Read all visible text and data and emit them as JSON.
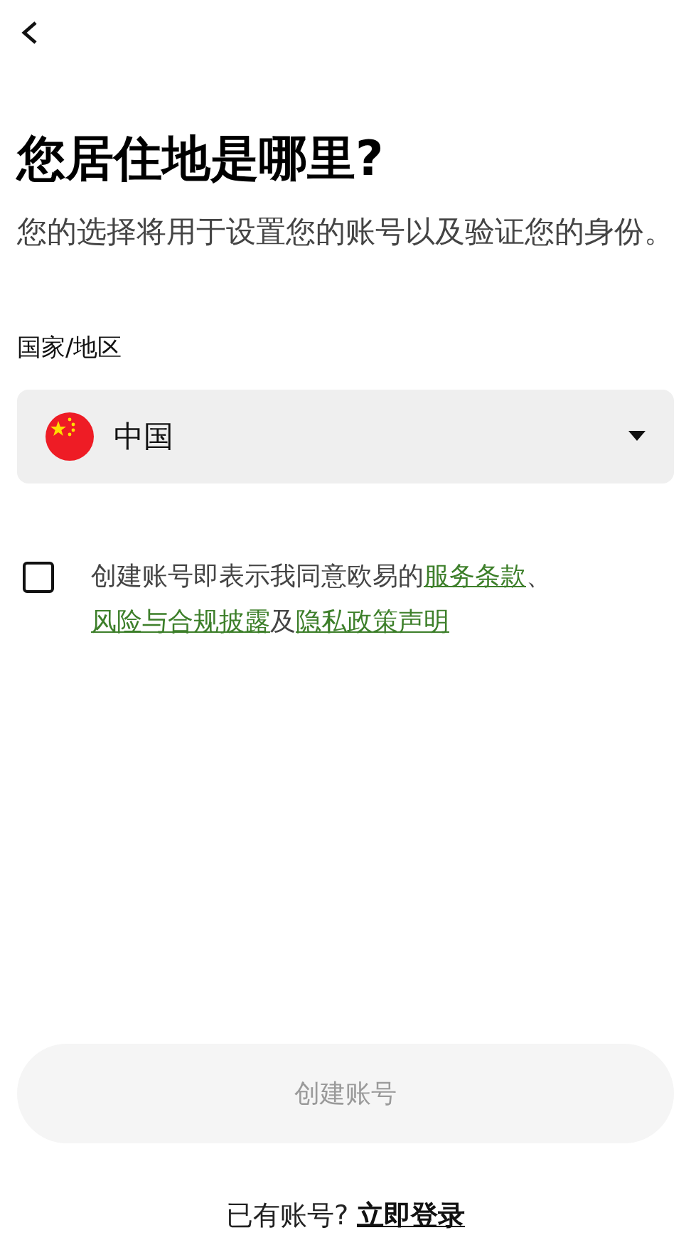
{
  "title": "您居住地是哪里?",
  "subtitle": "您的选择将用于设置您的账号以及验证您的身份。",
  "region_label": "国家/地区",
  "region_select": {
    "value": "中国"
  },
  "agreement": {
    "checked": false,
    "parts": [
      {
        "text": "创建账号即表示我同意欧易的",
        "kind": "plain"
      },
      {
        "text": "服务条款",
        "kind": "link"
      },
      {
        "text": "、",
        "kind": "plain"
      },
      {
        "text": "风险与合规披露",
        "kind": "link"
      },
      {
        "text": "及",
        "kind": "plain"
      },
      {
        "text": "隐私政策声明",
        "kind": "link"
      }
    ]
  },
  "create_button": {
    "label": "创建账号",
    "disabled": true
  },
  "login_prompt": {
    "text": "已有账号?",
    "link": "立即登录"
  }
}
